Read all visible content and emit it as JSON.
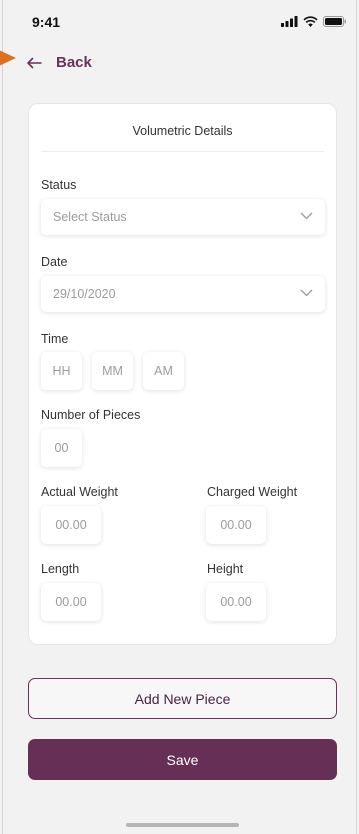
{
  "status_bar": {
    "time": "9:41",
    "icons": [
      "cellular-icon",
      "wifi-icon",
      "battery-icon"
    ]
  },
  "nav": {
    "back_label": "Back"
  },
  "card": {
    "title": "Volumetric Details",
    "status": {
      "label": "Status",
      "placeholder": "Select Status"
    },
    "date": {
      "label": "Date",
      "value": "29/10/2020"
    },
    "time": {
      "label": "Time",
      "hour": "HH",
      "minute": "MM",
      "ampm": "AM"
    },
    "pieces": {
      "label": "Number of Pieces",
      "value": "00"
    },
    "actual_weight": {
      "label": "Actual Weight",
      "value": "00.00"
    },
    "charged_weight": {
      "label": "Charged Weight",
      "value": "00.00"
    },
    "length": {
      "label": "Length",
      "value": "00.00"
    },
    "height": {
      "label": "Height",
      "value": "00.00"
    }
  },
  "buttons": {
    "add_piece": "Add New Piece",
    "save": "Save"
  },
  "colors": {
    "brand": "#662f55",
    "pointer": "#e0701d",
    "background": "#f2f2f2"
  }
}
